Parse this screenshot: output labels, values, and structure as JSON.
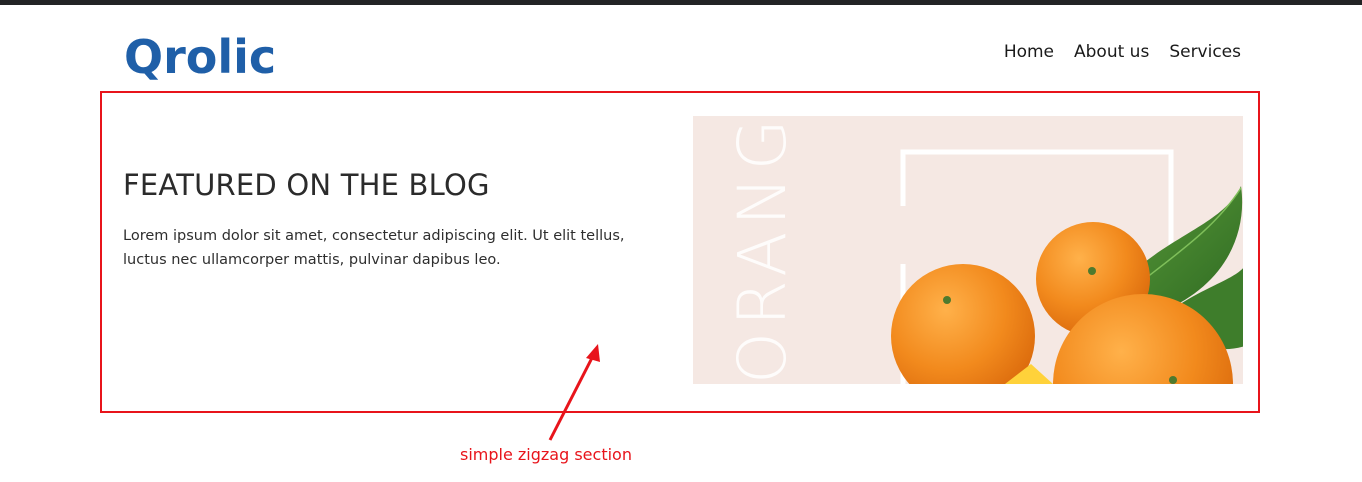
{
  "header": {
    "logo_text": "Qrolic",
    "nav": [
      {
        "label": "Home"
      },
      {
        "label": "About us"
      },
      {
        "label": "Services"
      }
    ]
  },
  "section": {
    "title": "FEATURED ON THE BLOG",
    "text": "Lorem ipsum dolor sit amet, consectetur adipiscing elit. Ut elit tellus, luctus nec ullamcorper mattis, pulvinar dapibus leo.",
    "image": {
      "vertical_word": "ORANGE"
    }
  },
  "annotation": {
    "label": "simple zigzag section",
    "color": "#e8141b"
  },
  "colors": {
    "brand_blue": "#1f5fa8",
    "image_bg": "#f5e8e3",
    "orange": "#f08a1c"
  }
}
